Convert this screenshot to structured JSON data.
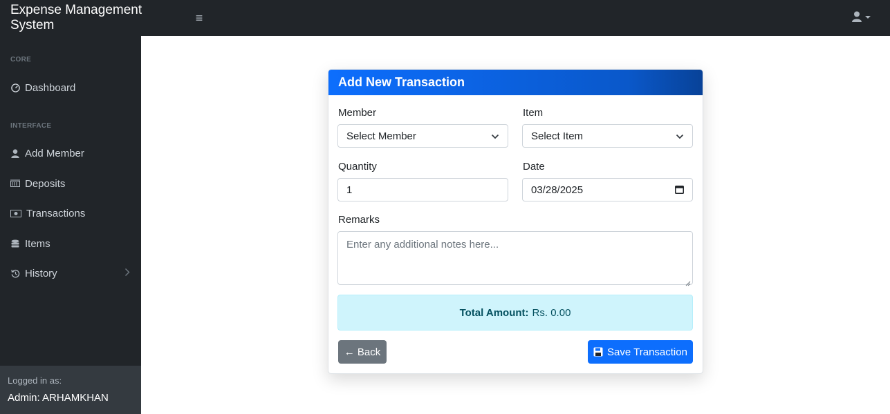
{
  "app": {
    "title": "Expense Management System"
  },
  "topbar": {
    "menu_icon": "bars-icon",
    "user_icon": "user-icon"
  },
  "sidebar": {
    "headings": [
      "CORE",
      "INTERFACE"
    ],
    "items": [
      {
        "label": "Dashboard",
        "icon": "tachometer-icon"
      },
      {
        "label": "Add Member",
        "icon": "user-icon"
      },
      {
        "label": "Deposits",
        "icon": "money-bill-icon"
      },
      {
        "label": "Transactions",
        "icon": "money-bill-wave-icon"
      },
      {
        "label": "Items",
        "icon": "database-icon"
      },
      {
        "label": "History",
        "icon": "history-icon"
      }
    ],
    "footer": {
      "label": "Logged in as:",
      "user": "Admin: ARHAMKHAN"
    }
  },
  "form": {
    "title": "Add New Transaction",
    "member": {
      "label": "Member",
      "value": "Select Member"
    },
    "item": {
      "label": "Item",
      "value": "Select Item"
    },
    "quantity": {
      "label": "Quantity",
      "value": "1"
    },
    "date": {
      "label": "Date",
      "value": "03/28/2025"
    },
    "remarks": {
      "label": "Remarks",
      "placeholder": "Enter any additional notes here..."
    },
    "total": {
      "label": "Total Amount:",
      "value": "Rs. 0.00"
    },
    "back_label": "← Back",
    "save_label": "Save Transaction"
  },
  "colors": {
    "primary": "#0d6efd",
    "dark": "#212529",
    "info_bg": "#cff4fc",
    "secondary": "#6c757d"
  }
}
